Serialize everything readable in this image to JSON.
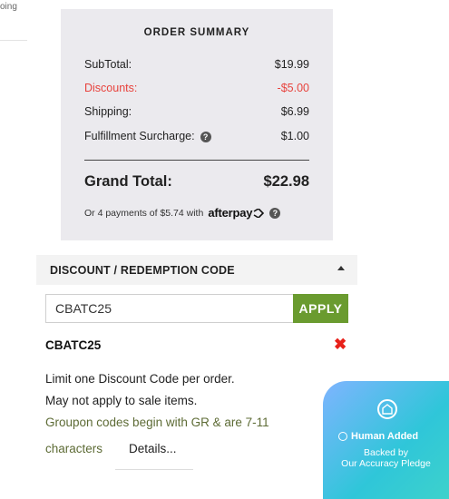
{
  "page_edge": {
    "cut_text": "oing"
  },
  "order_summary": {
    "title": "ORDER SUMMARY",
    "rows": [
      {
        "label": "SubTotal:",
        "value": "$19.99"
      },
      {
        "label": "Discounts:",
        "value": "-$5.00"
      },
      {
        "label": "Shipping:",
        "value": "$6.99"
      },
      {
        "label": "Fulfillment Surcharge:",
        "value": "$1.00"
      }
    ],
    "grand_total_label": "Grand Total:",
    "grand_total_value": "$22.98",
    "afterpay_text": "Or 4 payments of $5.74 with",
    "afterpay_logo": "afterpay",
    "accent_red": "#e8433d"
  },
  "discount": {
    "header_title": "DISCOUNT / REDEMPTION CODE",
    "input_value": "CBATC25",
    "apply_label": "APPLY",
    "applied_code": "CBATC25",
    "remove_icon": "close-x-icon",
    "notes": [
      "Limit one Discount Code per order.",
      "May not apply to sale items.",
      "Groupon codes begin with GR & are 7-11",
      "characters"
    ],
    "details_link": "Details...",
    "apply_color": "#6a9b2f"
  },
  "badge": {
    "icon": "house-shield-icon",
    "title": "Human Added",
    "line1": "Backed by",
    "line2": "Our Accuracy Pledge"
  }
}
